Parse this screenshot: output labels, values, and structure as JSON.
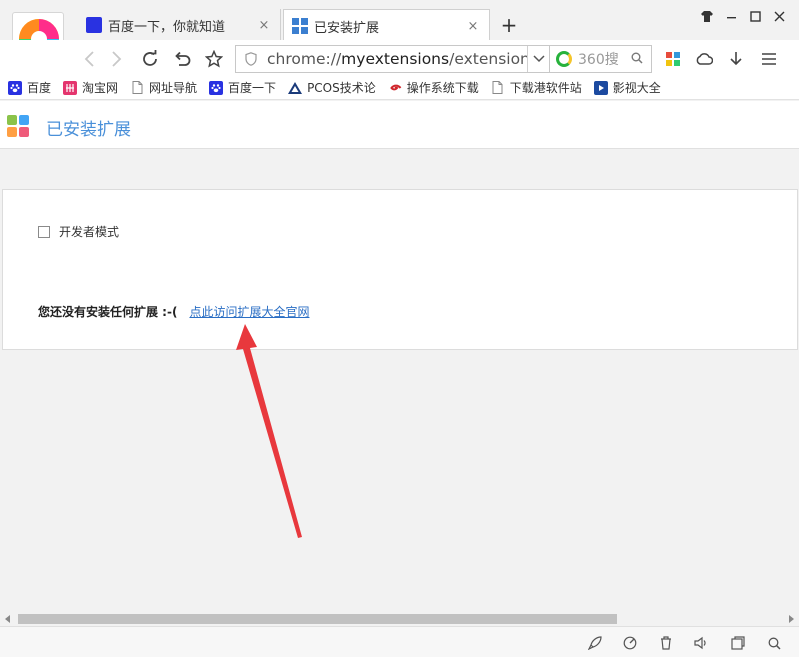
{
  "tabs": [
    {
      "label": "百度一下，你就知道",
      "close": "×"
    },
    {
      "label": "已安装扩展",
      "close": "×"
    }
  ],
  "new_tab_label": "+",
  "address": {
    "prefix": "chrome://",
    "host": "myextensions",
    "path": "/extensions,"
  },
  "search": {
    "label": "360搜"
  },
  "bookmarks": [
    {
      "label": "百度",
      "icon": "baidu-paw-icon",
      "color": "#2932e1"
    },
    {
      "label": "淘宝网",
      "icon": "taobao-icon",
      "color": "#e4356e"
    },
    {
      "label": "网址导航",
      "icon": "page-icon",
      "color": "#ffffff"
    },
    {
      "label": "百度一下",
      "icon": "baidu-paw-icon",
      "color": "#2932e1"
    },
    {
      "label": "PCOS技术论",
      "icon": "pcos-icon",
      "color": "#1a3a7a"
    },
    {
      "label": "操作系统下载",
      "icon": "spiral-icon",
      "color": "#d0262c"
    },
    {
      "label": "下载港软件站",
      "icon": "page-icon",
      "color": "#ffffff"
    },
    {
      "label": "影视大全",
      "icon": "film-icon",
      "color": "#1c4aa0"
    }
  ],
  "page": {
    "title": "已安装扩展",
    "developer_mode": "开发者模式",
    "empty_text": "您还没有安装任何扩展 :-(",
    "visit_link": "点此访问扩展大全官网"
  },
  "colors": {
    "accent": "#4a90d9",
    "link": "#2a6ec4",
    "arrow": "#e8383d"
  }
}
